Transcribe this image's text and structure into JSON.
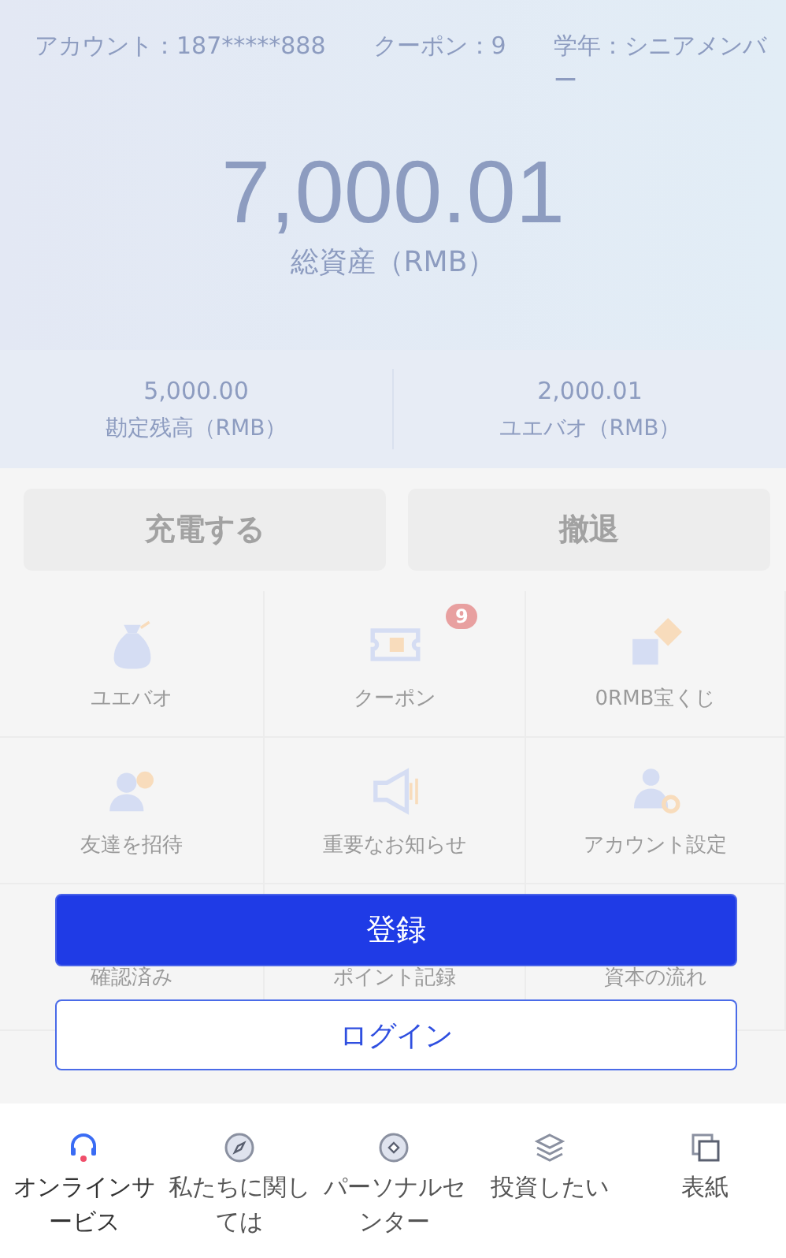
{
  "header": {
    "info": [
      "アカウント：187*****888",
      "クーポン：9",
      "学年：シニアメンバー"
    ],
    "total": "7,000.01",
    "total_label": "総資産（RMB）"
  },
  "balances": [
    {
      "value": "5,000.00",
      "label": "勘定残高（RMB）"
    },
    {
      "value": "2,000.01",
      "label": "ユエバオ（RMB）"
    }
  ],
  "actions": [
    "充電する",
    "撤退"
  ],
  "grid": [
    {
      "label": "ユエバオ"
    },
    {
      "label": "クーポン",
      "badge": "9"
    },
    {
      "label": "0RMB宝くじ"
    },
    {
      "label": "友達を招待"
    },
    {
      "label": "重要なお知らせ"
    },
    {
      "label": "アカウント設定"
    },
    {
      "label": "確認済み"
    },
    {
      "label": "ポイント記録"
    },
    {
      "label": "資本の流れ"
    }
  ],
  "modal": {
    "register": "登録",
    "login": "ログイン"
  },
  "bottom_nav": [
    {
      "label": "オンラインサービス",
      "selected": true
    },
    {
      "label": "私たちに関しては",
      "selected": false
    },
    {
      "label": "パーソナルセンター",
      "selected": false
    },
    {
      "label": "投資したい",
      "selected": false
    },
    {
      "label": "表紙",
      "selected": false
    }
  ]
}
